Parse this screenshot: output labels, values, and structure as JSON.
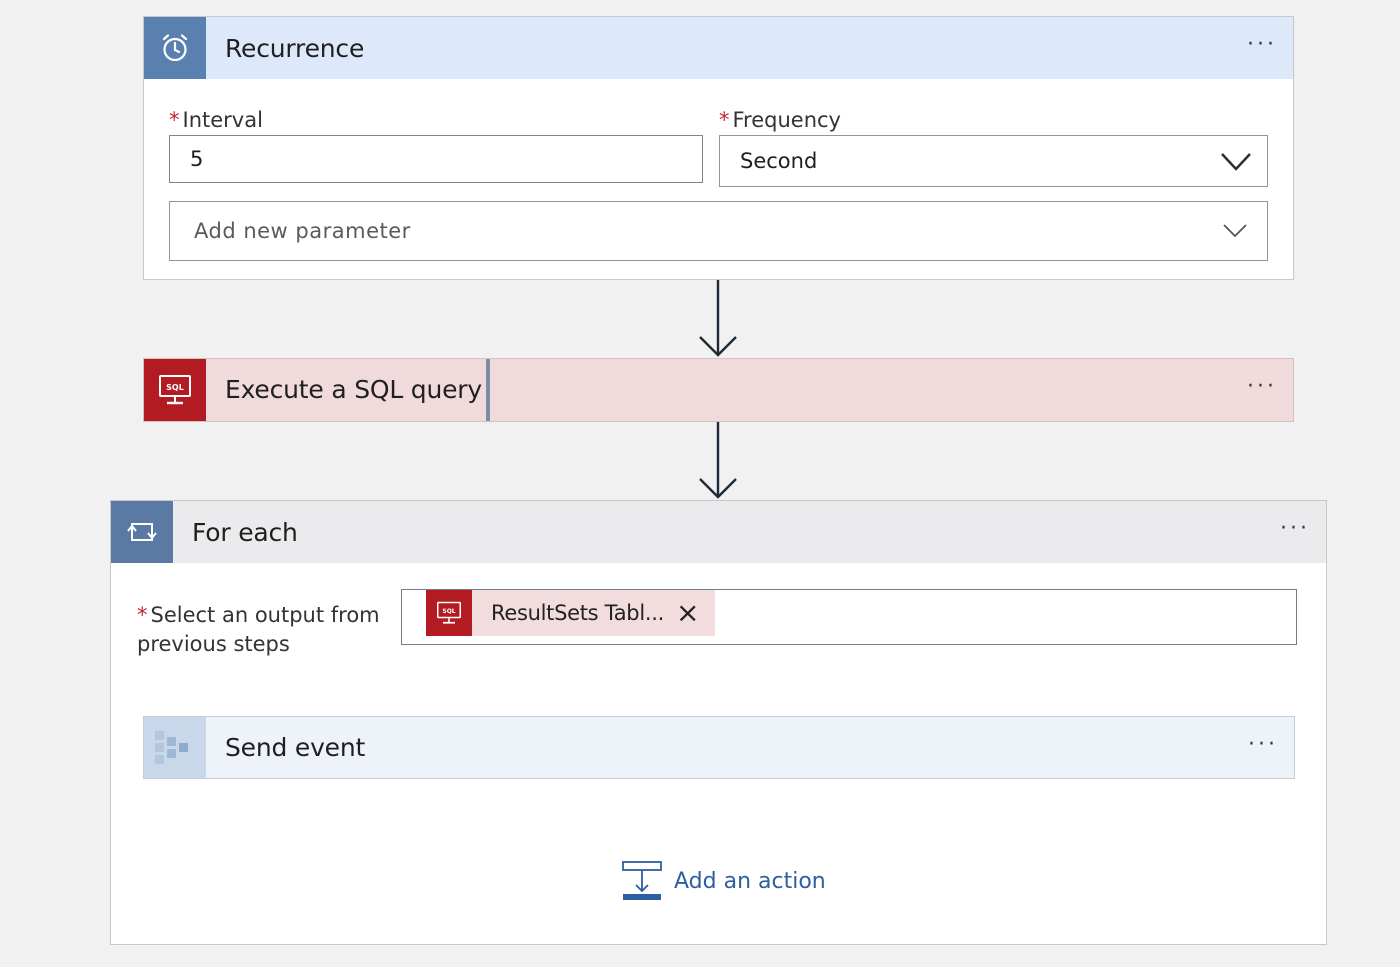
{
  "recurrence": {
    "title": "Recurrence",
    "icon": "alarm-clock-icon",
    "more": "···",
    "header_color": "#dde9fb",
    "icon_bg": "#5a80b0",
    "interval_label": "Interval",
    "interval_value": "5",
    "frequency_label": "Frequency",
    "frequency_value": "Second",
    "add_param_placeholder": "Add new parameter",
    "required_mark": "*"
  },
  "sql": {
    "title": "Execute a SQL query",
    "icon": "sql-monitor-icon",
    "icon_text": "SQL",
    "more": "···",
    "header_color": "#f0dadc",
    "icon_bg": "#b31b22"
  },
  "foreach": {
    "title": "For each",
    "icon": "loop-icon",
    "more": "···",
    "header_color": "#ebebee",
    "icon_bg": "#5a7aa4",
    "select_label": "Select an output from",
    "select_label_line2": "previous steps",
    "required_mark": "*",
    "token_label": "ResultSets Tabl...",
    "token_icon_text": "SQL",
    "token_close": "×"
  },
  "send_event": {
    "title": "Send event",
    "icon": "event-hub-icon",
    "more": "···",
    "header_color": "#eef3fa"
  },
  "add_action": {
    "label": "Add an action",
    "icon": "add-action-icon",
    "color": "#2e5ea0"
  }
}
